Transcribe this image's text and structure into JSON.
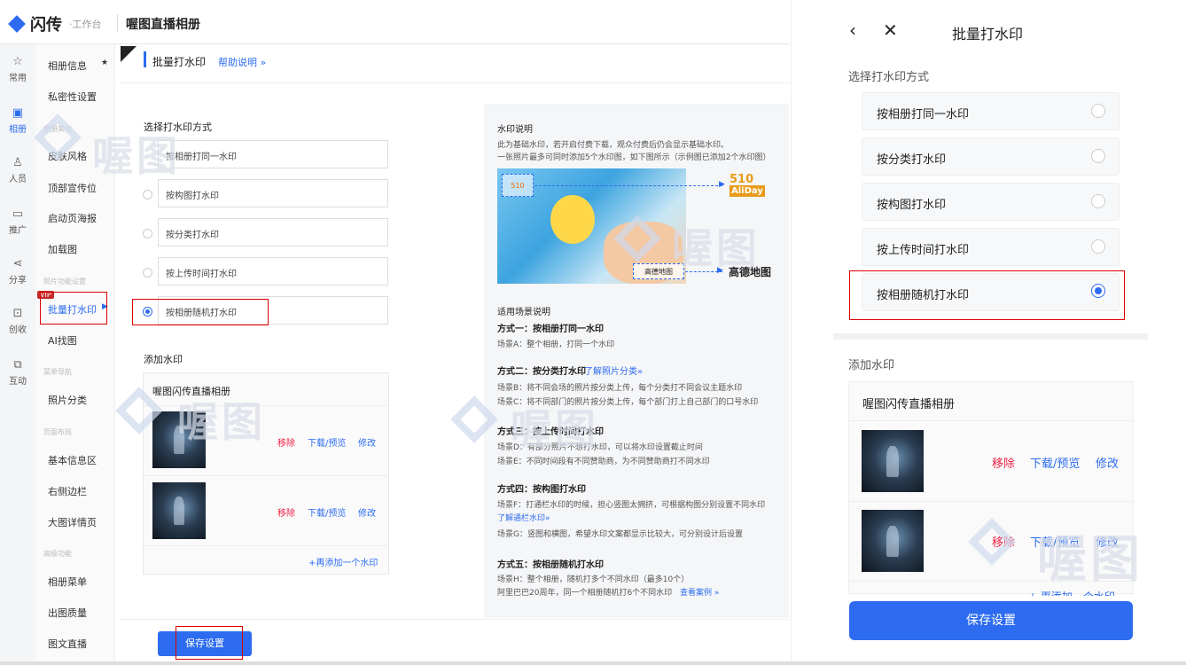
{
  "header": {
    "logo": "闪传",
    "logo_sub": "·工作台",
    "app_title": "喔图直播相册"
  },
  "iconbar": [
    {
      "label": "常用",
      "icon": "star-icon"
    },
    {
      "label": "相册",
      "icon": "album-icon"
    },
    {
      "label": "人员",
      "icon": "user-icon"
    },
    {
      "label": "推广",
      "icon": "monitor-icon"
    },
    {
      "label": "分享",
      "icon": "share-icon"
    },
    {
      "label": "创收",
      "icon": "revenue-icon"
    },
    {
      "label": "互动",
      "icon": "interact-icon"
    }
  ],
  "menu": {
    "items": [
      "相册信息",
      "私密性设置",
      "皮肤风格",
      "顶部宣传位",
      "启动页海报",
      "加载图",
      "批量打水印",
      "AI找图",
      "照片分类",
      "基本信息区",
      "右侧边栏",
      "大图详情页",
      "相册菜单",
      "出图质量",
      "图文直播"
    ],
    "groups": [
      "相册美化",
      "照片功能设置",
      "菜单导航",
      "页面布局",
      "高级功能"
    ],
    "badge": "VIP"
  },
  "main": {
    "crumb": "批量打水印",
    "help": "帮助说明 »",
    "section_mode": "选择打水印方式",
    "options": [
      "按相册打同一水印",
      "按构图打水印",
      "按分类打水印",
      "按上传时间打水印",
      "按相册随机打水印"
    ],
    "section_add": "添加水印",
    "card_title": "喔图闪传直播相册",
    "remove": "移除",
    "download": "下载/预览",
    "edit": "修改",
    "add_more": "+再添加一个水印",
    "save": "保存设置"
  },
  "desc": {
    "title": "水印说明",
    "line1": "此为基础水印，若开启付费下载，观众付费后仍会显示基础水印。",
    "line2": "一张照片最多可同时添加5个水印图，如下图所示（示例图已添加2个水印图）",
    "wm_label": "高德地图",
    "logo1": "510",
    "logo1b": "AliDay",
    "logo2": "高德地图",
    "scene_title": "适用场景说明",
    "m1_title": "方式一：按相册打同一水印",
    "m1_a": "场景A：整个相册，打同一个水印",
    "m2_title": "方式二：按分类打水印",
    "m2_link": "了解照片分类»",
    "m2_b": "场景B：将不同会场的照片按分类上传，每个分类打不同会议主题水印",
    "m2_c": "场景C：将不同部门的照片按分类上传，每个部门打上自己部门的口号水印",
    "m3_title": "方式三：按上传时间打水印",
    "m3_d": "场景D：有部分照片不想打水印，可以将水印设置截止时间",
    "m3_e": "场景E：不同时间段有不同赞助商，为不同赞助商打不同水印",
    "m4_title": "方式四：按构图打水印",
    "m4_f": "场景F：打通栏水印的时候，担心竖图太拥挤，可根据构图分别设置不同水印",
    "m4_link": "了解通栏水印»",
    "m4_g": "场景G：竖图和横图，希望水印文案都显示比较大，可分别设计后设置",
    "m5_title": "方式五：按相册随机打水印",
    "m5_h": "场景H：整个相册，随机打多个不同水印（最多10个）",
    "m5_i": "阿里巴巴20周年，同一个相册随机打6个不同水印",
    "m5_link": "查看案例 »"
  },
  "watermark_text": "喔图",
  "mobile": {
    "title": "批量打水印",
    "section_mode": "选择打水印方式",
    "options": [
      "按相册打同一水印",
      "按分类打水印",
      "按构图打水印",
      "按上传时间打水印",
      "按相册随机打水印"
    ],
    "section_add": "添加水印",
    "card_title": "喔图闪传直播相册",
    "remove": "移除",
    "download": "下载/预览",
    "edit": "修改",
    "cut_text": "+ 再添加一个水印",
    "save": "保存设置"
  },
  "colors": {
    "accent": "#2d6cf0",
    "danger": "#e24444",
    "highlight_box": "#d00000"
  }
}
